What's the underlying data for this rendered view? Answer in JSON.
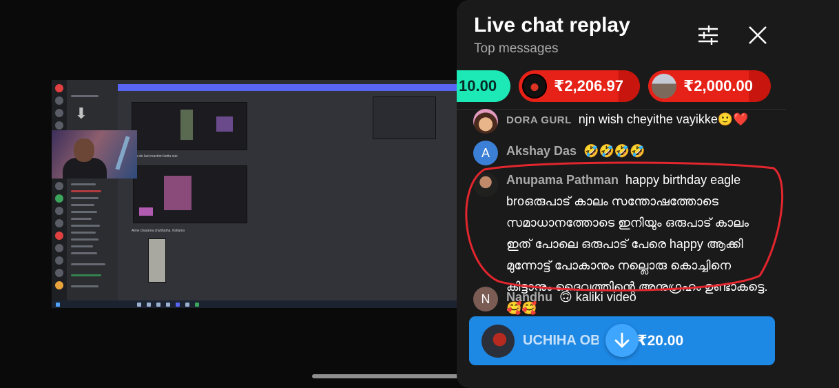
{
  "panel": {
    "title": "Live chat replay",
    "subtitle": "Top messages"
  },
  "chips": [
    {
      "amount": "10.00",
      "color": "#1de9b6"
    },
    {
      "amount": "₹2,206.97",
      "color": "#e62117"
    },
    {
      "amount": "₹2,000.00",
      "color": "#e62117"
    }
  ],
  "messages": [
    {
      "author": "DORA GURL",
      "text": "njn wish cheyithe vayikke🙂❤️"
    },
    {
      "author": "Akshay Das",
      "avatar_letter": "A",
      "text": "🤣🤣🤣🤣"
    },
    {
      "author": "Anupama Pathman",
      "text": "happy birthday eagle broഒരുപാട് കാലം സന്തോഷത്തോടെ സമാധാനത്തോടെ ഇനിയും ഒരുപാട് കാലം ഇത് പോലെ ഒരുപാട് പേരെ happy ആക്കി മുന്നോട്ട് പോകാനും നല്ലൊരു കൊച്ചിനെ കിട്ടാനും ദൈവത്തിന്റെ അനുഗ്രഹം ഉണ്ടാകട്ടെ.🥰🥰"
    },
    {
      "author": "Nandhu",
      "avatar_letter": "N",
      "text": "🙃   kaliki video"
    }
  ],
  "pinned": {
    "name": "UCHIHA OB",
    "amount": "₹20.00",
    "color": "#1e88e5"
  },
  "icons": {
    "filter": "sliders-icon",
    "close": "close-icon",
    "scroll": "arrow-down-icon"
  }
}
